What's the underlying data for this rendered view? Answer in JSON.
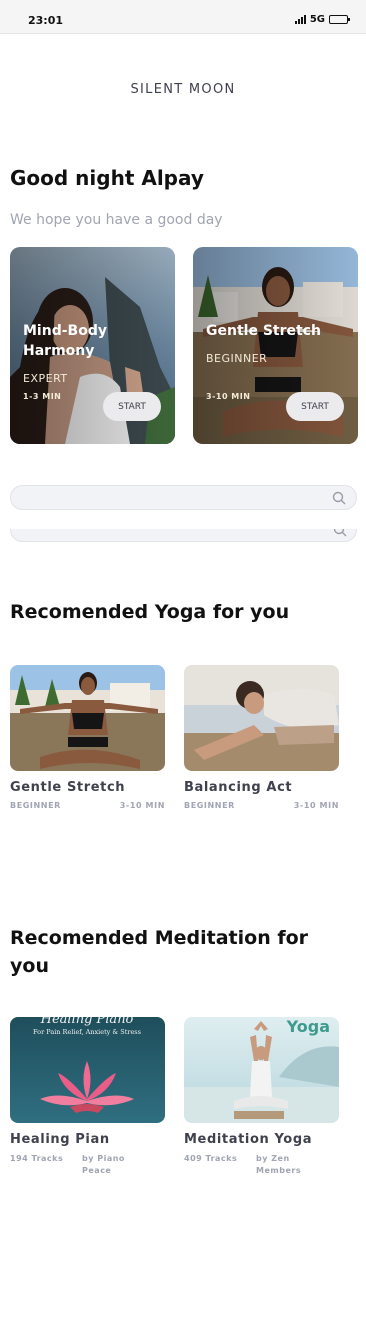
{
  "status": {
    "time": "23:01",
    "network": "5G"
  },
  "brand": "SILENT MOON",
  "greeting": "Good night Alpay",
  "subgreeting": "We hope you have a good day",
  "featured": [
    {
      "title": "Mind-Body Harmony",
      "level": "EXPERT",
      "duration": "1-3 MIN",
      "button": "START"
    },
    {
      "title": "Gentle Stretch",
      "level": "BEGINNER",
      "duration": "3-10 MIN",
      "button": "START"
    }
  ],
  "search": {
    "placeholder": ""
  },
  "sections": {
    "yoga_title": "Recomended Yoga for you",
    "meditation_title": "Recomended Meditation for you"
  },
  "yoga": [
    {
      "title": "Gentle Stretch",
      "level": "BEGINNER",
      "duration": "3-10 MIN"
    },
    {
      "title": "Balancing Act",
      "level": "BEGINNER",
      "duration": "3-10 MIN"
    }
  ],
  "meditation": [
    {
      "title": "Healing Pian",
      "tracks": "194 Tracks",
      "author": "by Piano Peace",
      "art_title": "Healing Piano",
      "art_subtitle": "For Pain Relief, Anxiety & Stress"
    },
    {
      "title": "Meditation Yoga",
      "tracks": "409 Tracks",
      "author": "by Zen Members",
      "art_title": "Yoga"
    }
  ]
}
